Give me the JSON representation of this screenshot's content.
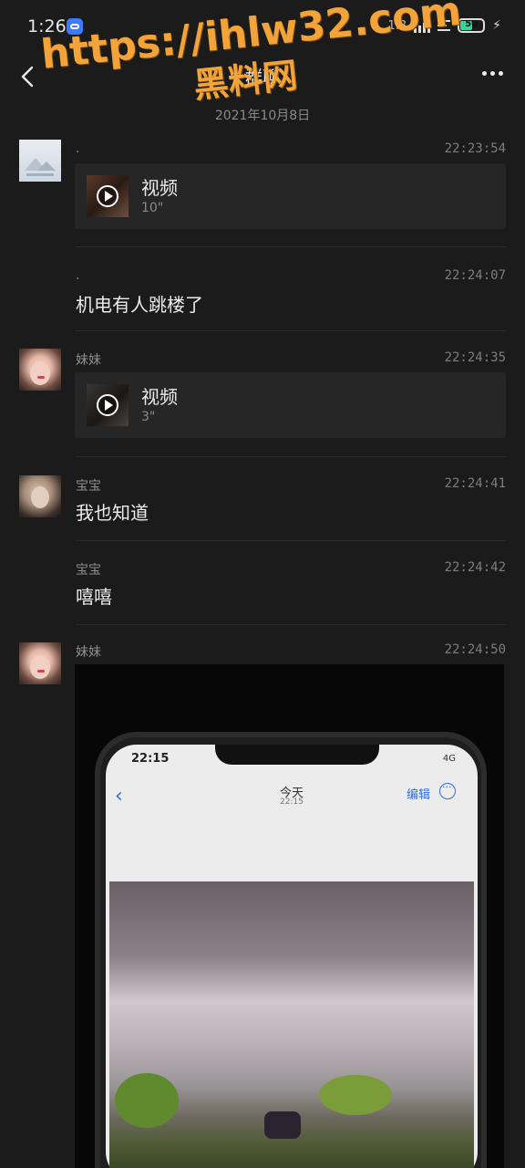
{
  "status_bar": {
    "time": "1:26",
    "battery_level": "50",
    "speed": "1.3"
  },
  "header": {
    "title": "群聊",
    "date": "2021年10月8日"
  },
  "watermark": {
    "url": "https://ihlw32.com",
    "text": "黑料网"
  },
  "messages": [
    {
      "sender": ".",
      "time": "22:23:54",
      "type": "video",
      "label": "视频",
      "duration": "10\""
    },
    {
      "sender": ".",
      "time": "22:24:07",
      "type": "text",
      "text": "机电有人跳楼了"
    },
    {
      "sender": "妹妹",
      "time": "22:24:35",
      "type": "video",
      "label": "视频",
      "duration": "3\""
    },
    {
      "sender": "宝宝",
      "time": "22:24:41",
      "type": "text",
      "text": "我也知道"
    },
    {
      "sender": "宝宝",
      "time": "22:24:42",
      "type": "text",
      "text": "嘻嘻"
    },
    {
      "sender": "妹妹",
      "time": "22:24:50",
      "type": "image"
    }
  ],
  "photo_screen": {
    "time": "22:15",
    "network": "4G",
    "title": "今天",
    "subtitle": "22:15",
    "edit_label": "编辑"
  },
  "colors": {
    "background": "#1b1b1b",
    "card": "#262626",
    "watermark": "#f2a33a",
    "battery": "#37d29a"
  }
}
